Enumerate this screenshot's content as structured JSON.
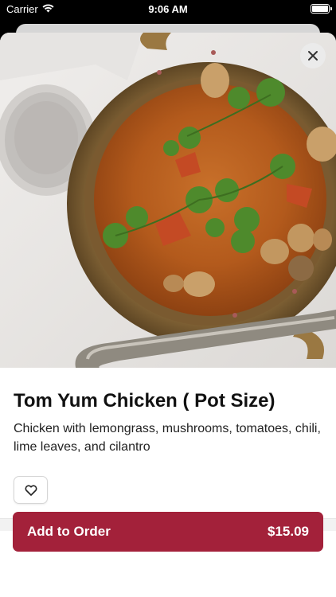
{
  "status": {
    "carrier": "Carrier",
    "time": "9:06 AM"
  },
  "item": {
    "title": "Tom Yum Chicken ( Pot Size)",
    "description": "Chicken with lemongrass, mushrooms, tomatoes, chili, lime leaves, and cilantro",
    "image_icon": "tom-yum-soup-photo"
  },
  "actions": {
    "close_icon": "close-icon",
    "favorite_icon": "heart-icon",
    "add_label": "Add to Order",
    "price": "$15.09"
  },
  "colors": {
    "accent": "#A3213A",
    "status_bar": "#000000",
    "background": "#FFFFFF"
  }
}
